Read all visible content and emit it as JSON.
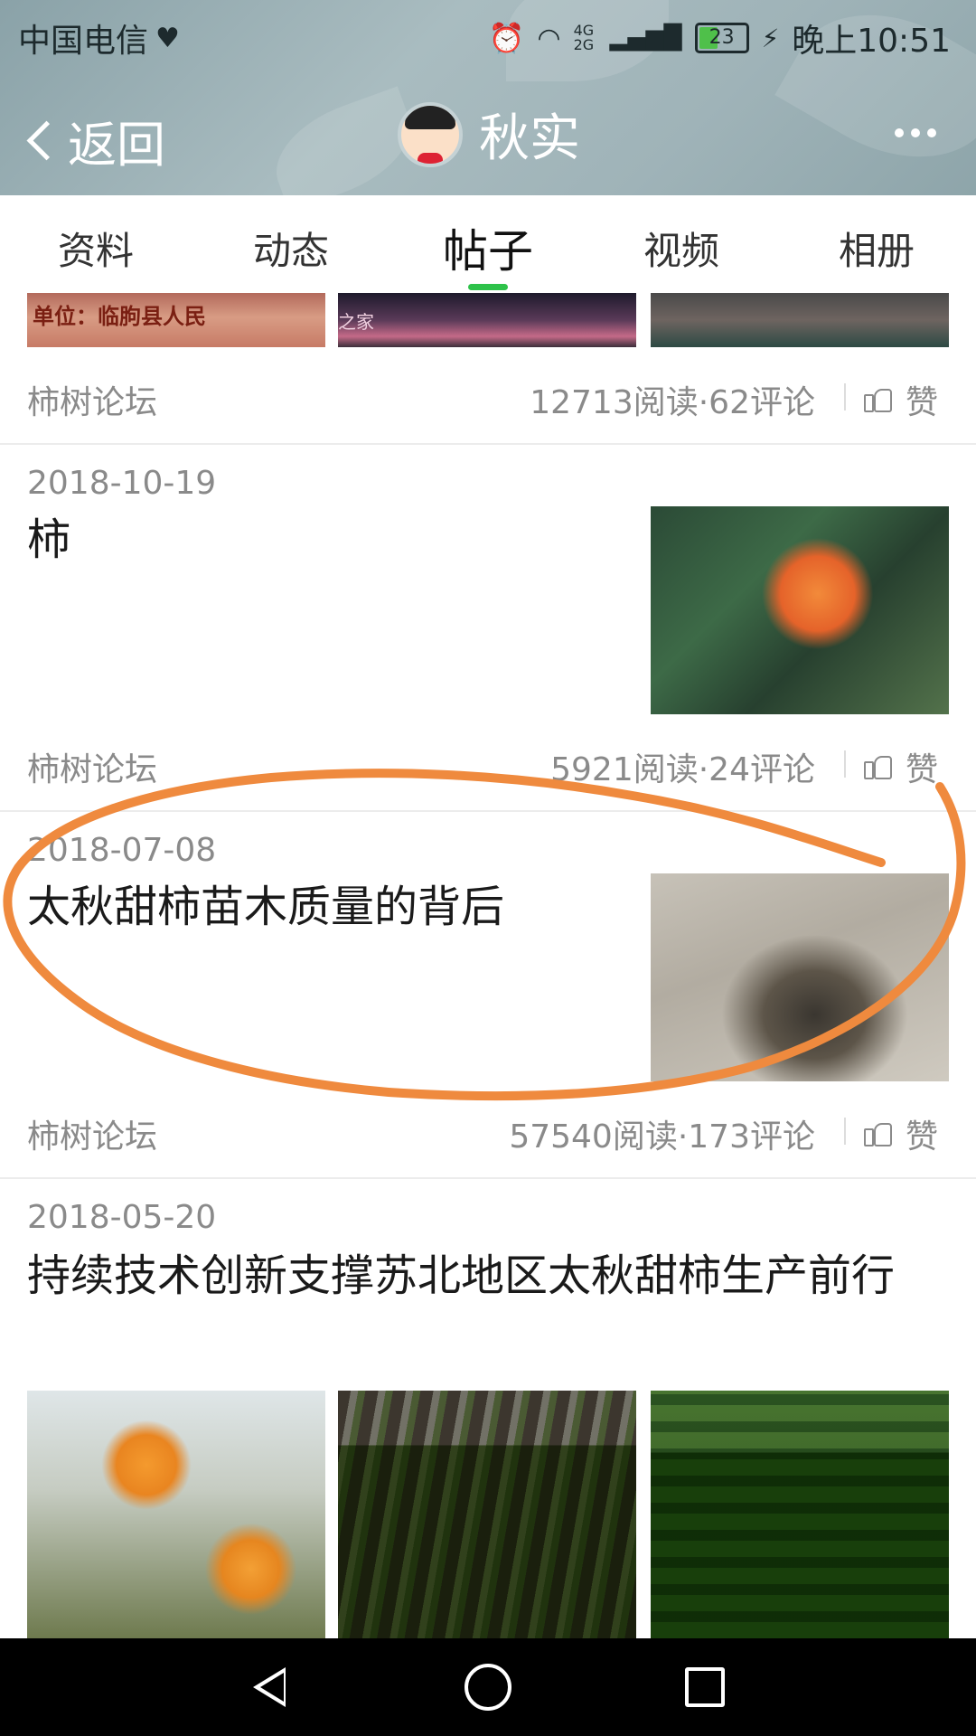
{
  "status_bar": {
    "carrier": "中国电信",
    "network": "4G 2G",
    "battery": "23",
    "time": "晚上10:51"
  },
  "nav": {
    "back_label": "返回",
    "title": "秋实"
  },
  "tabs": [
    "资料",
    "动态",
    "帖子",
    "视频",
    "相册"
  ],
  "active_tab": "帖子",
  "posts": [
    {
      "source": "柿树论坛",
      "stats": "12713阅读·62评论",
      "like_label": "赞"
    },
    {
      "date": "2018-10-19",
      "title": "柿",
      "source": "柿树论坛",
      "stats": "5921阅读·24评论",
      "like_label": "赞"
    },
    {
      "date": "2018-07-08",
      "title": "太秋甜柿苗木质量的背后",
      "source": "柿树论坛",
      "stats": "57540阅读·173评论",
      "like_label": "赞"
    },
    {
      "date": "2018-05-20",
      "title": "持续技术创新支撑苏北地区太秋甜柿生产前行"
    }
  ],
  "image_texts": [
    "单位：临朐县人民",
    "之家"
  ],
  "colors": {
    "accent_green": "#2ec24a",
    "annotation_orange": "#ef8a3e"
  }
}
